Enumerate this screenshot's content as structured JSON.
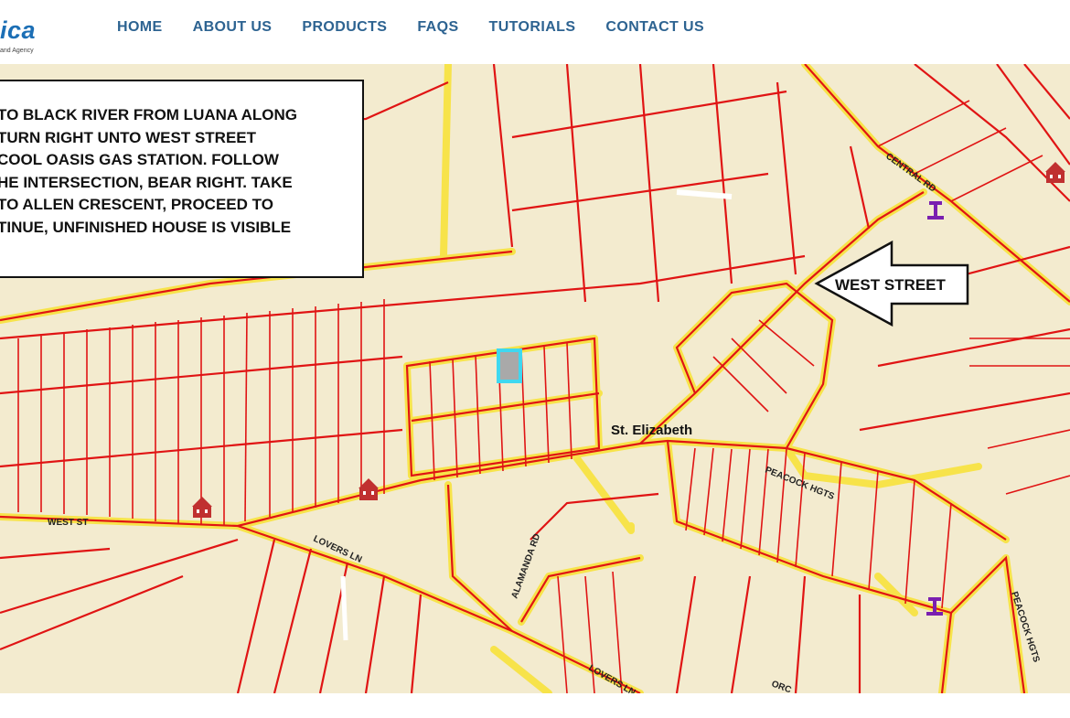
{
  "header": {
    "logo_text": "ica",
    "logo_tagline": "and Agency",
    "nav": [
      "HOME",
      "ABOUT US",
      "PRODUCTS",
      "FAQS",
      "TUTORIALS",
      "CONTACT US"
    ]
  },
  "directions": [
    "TO BLACK RIVER FROM LUANA ALONG",
    "TURN RIGHT UNTO WEST STREET",
    "COOL OASIS GAS STATION. FOLLOW",
    "HE INTERSECTION, BEAR RIGHT. TAKE",
    "TO ALLEN CRESCENT, PROCEED TO",
    "TINUE, UNFINISHED HOUSE IS VISIBLE"
  ],
  "map": {
    "arrow_label": "WEST STREET",
    "town": "St. Elizabeth",
    "roads": [
      "CENTRAL RD",
      "PEACOCK HGTS",
      "WEST ST",
      "LOVERS LN",
      "ALAMANDA RD",
      "PEACOCK HGTS",
      "LOVERS LN",
      "ORC"
    ],
    "colors": {
      "background": "#f3ebcf",
      "parcel_lines": "#e01414",
      "road_fill": "#f7e34a",
      "highlight": "#3fd8f0",
      "marker": "#7a1fb0"
    }
  }
}
